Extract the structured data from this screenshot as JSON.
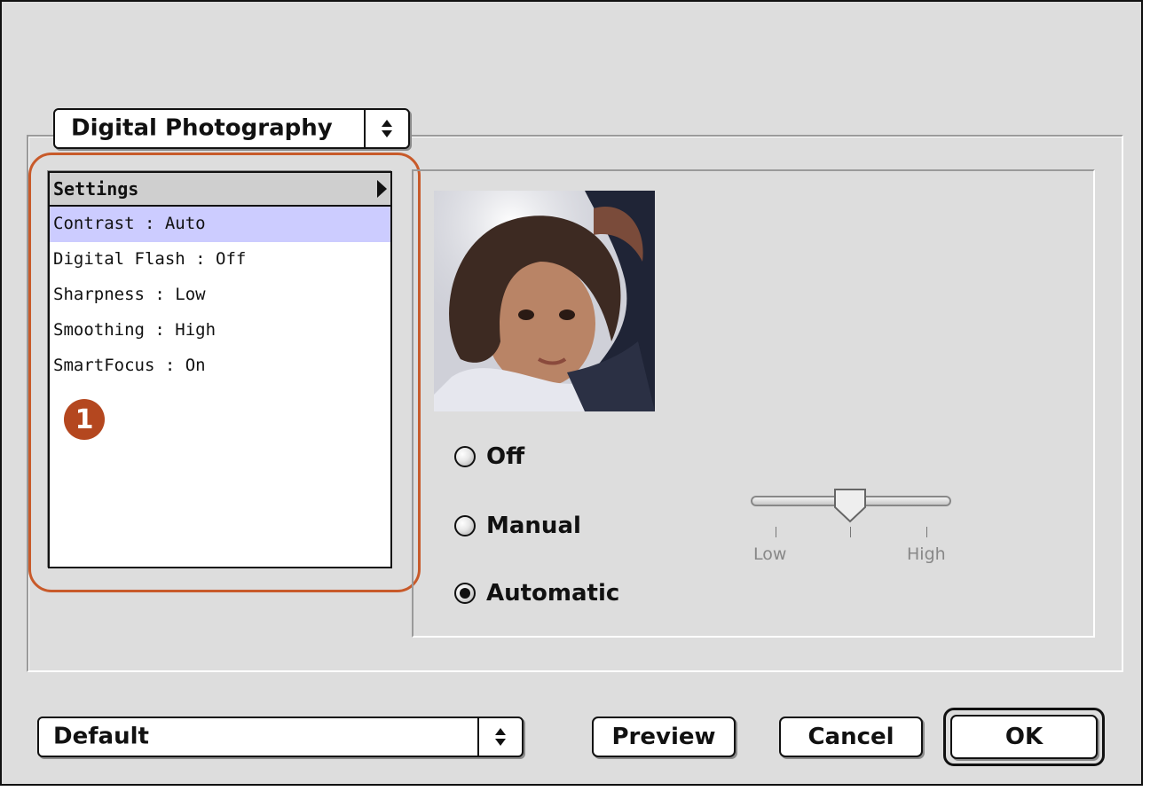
{
  "category_popup": {
    "label": "Digital Photography",
    "arrow_icon": "updown-arrows-icon"
  },
  "settings_list": {
    "header": "Settings",
    "items": [
      {
        "label": "Contrast : Auto",
        "selected": true
      },
      {
        "label": "Digital Flash : Off",
        "selected": false
      },
      {
        "label": "Sharpness : Low",
        "selected": false
      },
      {
        "label": "Smoothing : High",
        "selected": false
      },
      {
        "label": "SmartFocus : On",
        "selected": false
      }
    ]
  },
  "callout_badge": {
    "number": "1",
    "color": "#b4471f"
  },
  "highlight_color": "#c85a2a",
  "contrast": {
    "options": [
      {
        "label": "Off",
        "checked": false
      },
      {
        "label": "Manual",
        "checked": false
      },
      {
        "label": "Automatic",
        "checked": true
      }
    ],
    "slider": {
      "low_label": "Low",
      "high_label": "High",
      "value_fraction": 0.5
    }
  },
  "preset_popup": {
    "label": "Default"
  },
  "buttons": {
    "preview": "Preview",
    "cancel": "Cancel",
    "ok": "OK"
  }
}
